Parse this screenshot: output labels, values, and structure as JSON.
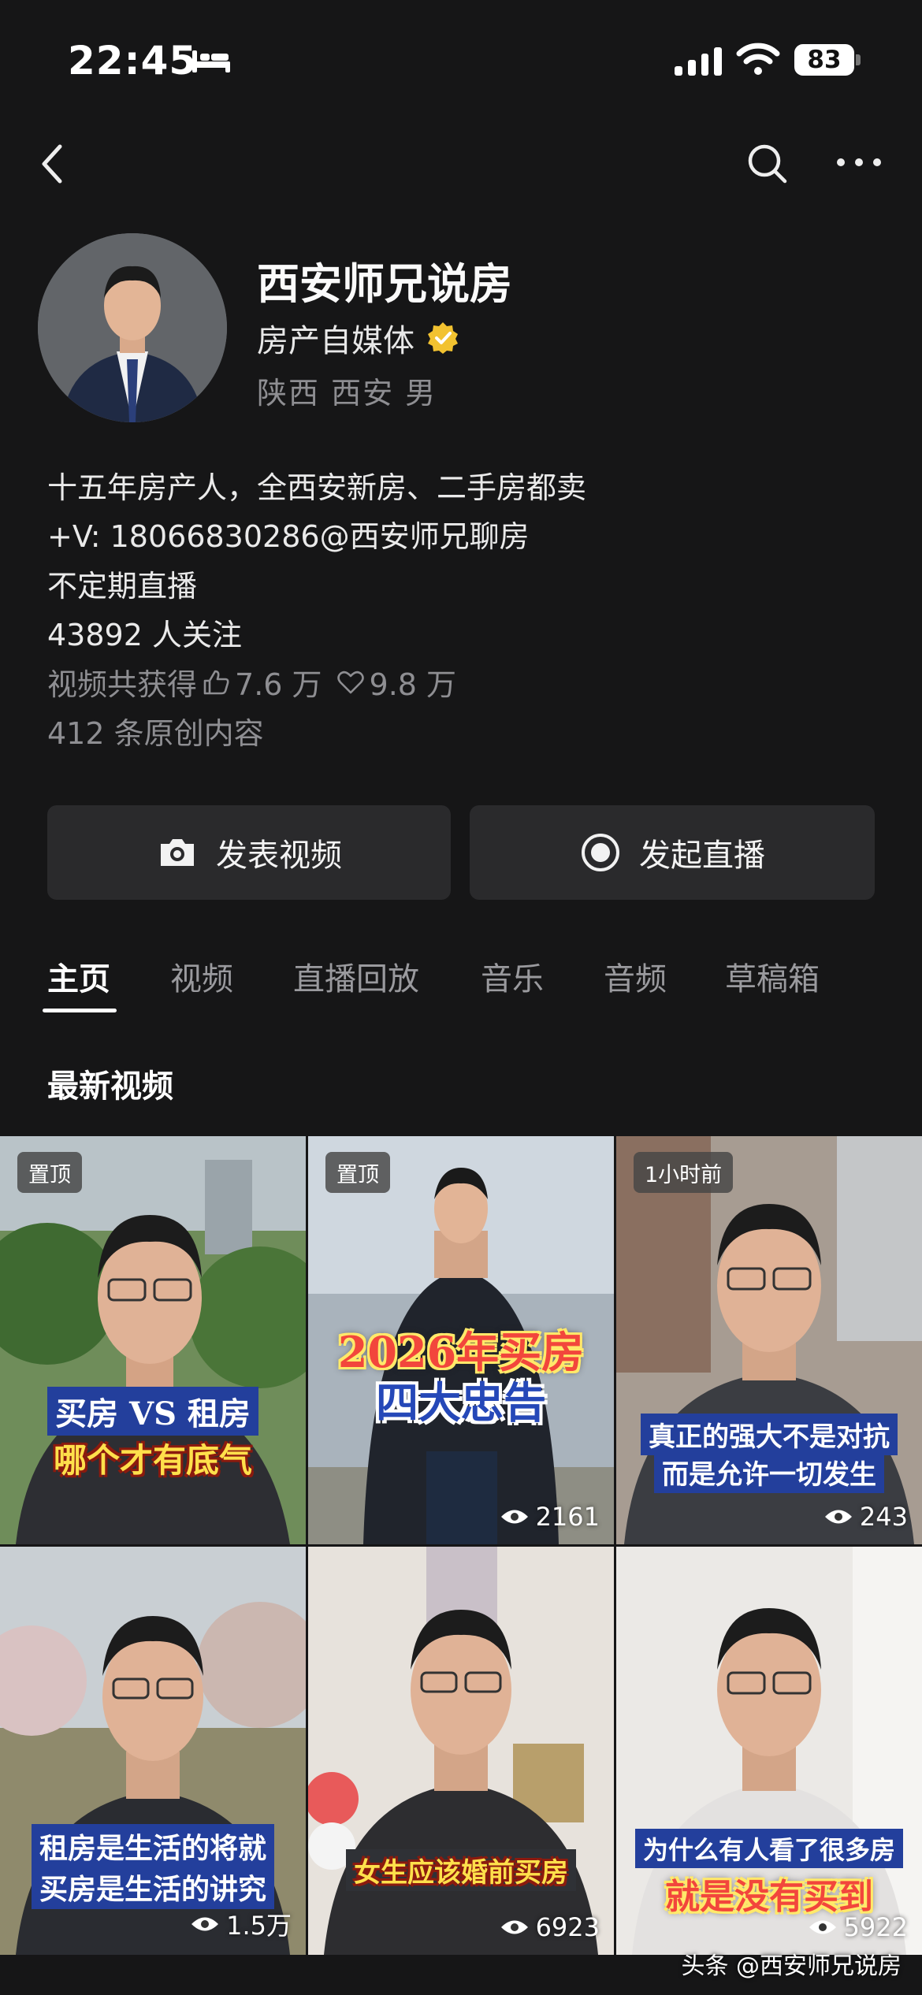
{
  "status_bar": {
    "time": "22:45",
    "battery": "83"
  },
  "profile": {
    "name": "西安师兄说房",
    "title": "房产自媒体",
    "location": "陕西 西安 男",
    "bio_lines": [
      "十五年房产人，全西安新房、二手房都卖",
      "+V: 18066830286@西安师兄聊房",
      "不定期直播"
    ],
    "followers": "43892 人关注",
    "stats_prefix": "视频共获得",
    "likes": "7.6 万",
    "favorites": "9.8 万",
    "works": "412 条原创内容"
  },
  "actions": {
    "post_video": "发表视频",
    "start_live": "发起直播"
  },
  "tabs": [
    "主页",
    "视频",
    "直播回放",
    "音乐",
    "音频",
    "草稿箱"
  ],
  "section_title": "最新视频",
  "videos": [
    {
      "badge": "置顶",
      "caption_lines": [
        "买房 VS 租房",
        "哪个才有底气"
      ],
      "views": ""
    },
    {
      "badge": "置顶",
      "caption_lines": [
        "2026年买房",
        "四大忠告"
      ],
      "views": "2161"
    },
    {
      "badge": "1小时前",
      "caption_lines": [
        "真正的强大不是对抗",
        "而是允许一切发生"
      ],
      "views": "243"
    },
    {
      "badge": "",
      "caption_lines": [
        "租房是生活的将就",
        "买房是生活的讲究"
      ],
      "views": "1.5万"
    },
    {
      "badge": "",
      "caption_lines": [
        "女生应该婚前买房"
      ],
      "views": "6923"
    },
    {
      "badge": "",
      "caption_lines": [
        "为什么有人看了很多房",
        "就是没有买到"
      ],
      "views": "5922"
    }
  ],
  "watermark": "头条 @西安师兄说房",
  "colors": {
    "background": "#161617",
    "button": "#2a2a2c",
    "muted_text": "#8e8e92",
    "verify_badge": "#f2c230"
  }
}
